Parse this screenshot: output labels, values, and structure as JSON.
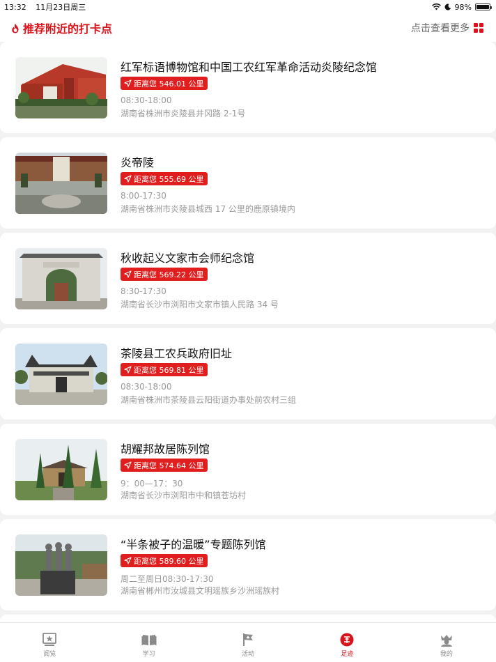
{
  "status_bar": {
    "time": "13:32",
    "date": "11月23日周三",
    "battery": "98%",
    "battery_level": 0.98
  },
  "header": {
    "title": "推荐附近的打卡点",
    "more": "点击查看更多"
  },
  "items": [
    {
      "title": "红军标语博物馆和中国工农红军革命活动炎陵纪念馆",
      "distance": "距离您 546.01 公里",
      "hours": "08:30-18:00",
      "address": "湖南省株洲市炎陵县井冈路 2-1号"
    },
    {
      "title": "炎帝陵",
      "distance": "距离您 555.69 公里",
      "hours": "8:00-17:30",
      "address": "湖南省株洲市炎陵县城西 17 公里的鹿原镇境内"
    },
    {
      "title": "秋收起义文家市会师纪念馆",
      "distance": "距离您 569.22 公里",
      "hours": "8:30-17:30",
      "address": "湖南省长沙市浏阳市文家市镇人民路 34 号"
    },
    {
      "title": "茶陵县工农兵政府旧址",
      "distance": "距离您 569.81 公里",
      "hours": "08:30-18:00",
      "address": "湖南省株洲市茶陵县云阳街道办事处前农村三组"
    },
    {
      "title": "胡耀邦故居陈列馆",
      "distance": "距离您 574.64 公里",
      "hours": "9：00—17：30",
      "address": "湖南省长沙市浏阳市中和镇苍坊村"
    },
    {
      "title": "“半条被子的温暖”专题陈列馆",
      "distance": "距离您 589.60 公里",
      "hours": "周二至周日08:30-17:30",
      "address": "湖南省郴州市汝城县文明瑶族乡沙洲瑶族村"
    }
  ],
  "tabs": [
    {
      "label": "阅览",
      "icon": "reading-icon",
      "active": false
    },
    {
      "label": "学习",
      "icon": "book-icon",
      "active": false
    },
    {
      "label": "活动",
      "icon": "flag-icon",
      "active": false
    },
    {
      "label": "足迹",
      "icon": "footprint-icon",
      "active": true
    },
    {
      "label": "我的",
      "icon": "user-crown-icon",
      "active": false
    }
  ],
  "colors": {
    "accent": "#d9131b",
    "badge": "#e01e1e",
    "muted": "#9a9a9a",
    "background": "#f2f2f2"
  }
}
